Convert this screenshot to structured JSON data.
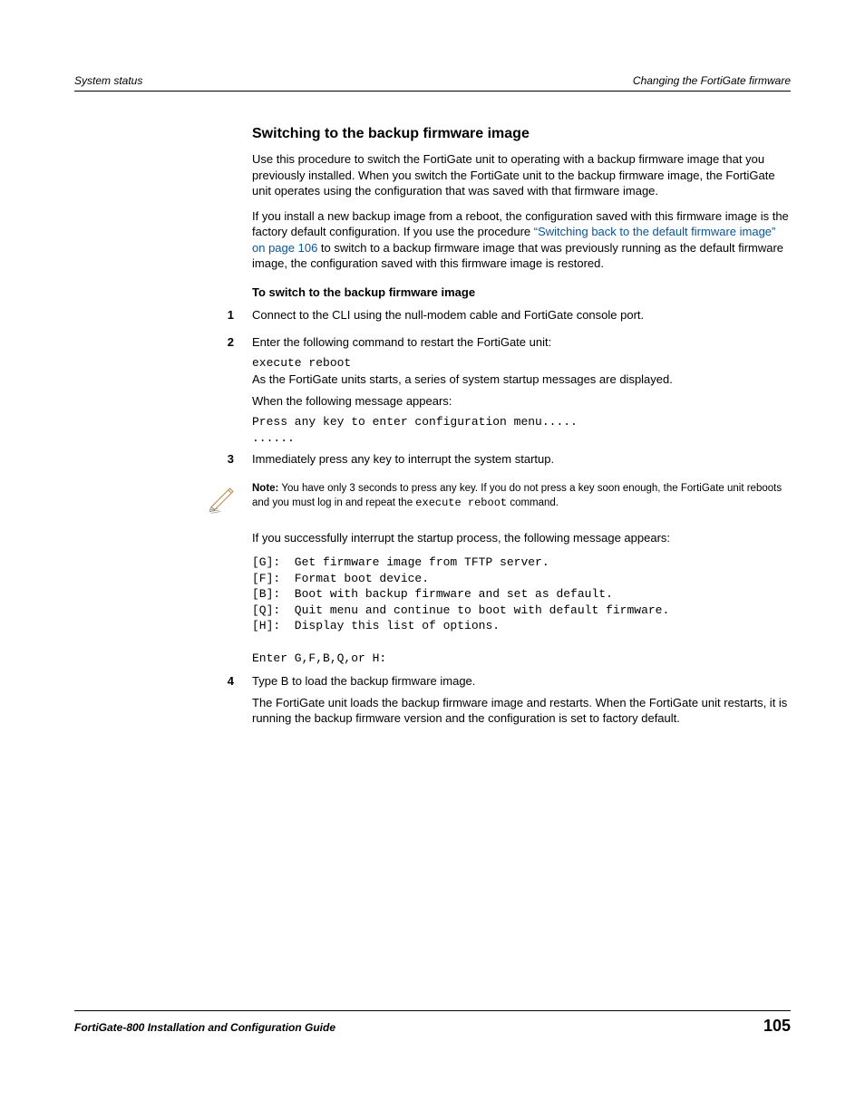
{
  "header": {
    "left": "System status",
    "right": "Changing the FortiGate firmware"
  },
  "title": "Switching to the backup firmware image",
  "intro1": "Use this procedure to switch the FortiGate unit to operating with a backup firmware image that you previously installed. When you switch the FortiGate unit to the backup firmware image, the FortiGate unit operates using the configuration that was saved with that firmware image.",
  "intro2_a": "If you install a new backup image from a reboot, the configuration saved with this firmware image is the factory default configuration. If you use the procedure ",
  "intro2_link": "“Switching back to the default firmware image” on page 106",
  "intro2_b": " to switch to a backup firmware image that was previously running as the default firmware image, the configuration saved with this firmware image is restored.",
  "subhead": "To switch to the backup firmware image",
  "steps": {
    "s1": {
      "num": "1",
      "text": "Connect to the CLI using the null-modem cable and FortiGate console port."
    },
    "s2": {
      "num": "2",
      "text": "Enter the following command to restart the FortiGate unit:",
      "cmd": "execute reboot",
      "after1": "As the FortiGate units starts, a series of system startup messages are displayed.",
      "after2": "When the following message appears:",
      "msg": "Press any key to enter configuration menu.....\n......"
    },
    "s3": {
      "num": "3",
      "text": "Immediately press any key to interrupt the system startup."
    },
    "s4": {
      "num": "4",
      "text": "Type B to load the backup firmware image.",
      "after": "The FortiGate unit loads the backup firmware image and restarts. When the FortiGate unit restarts, it is running the backup firmware version and the configuration is set to factory default."
    }
  },
  "note": {
    "label": "Note:",
    "text_a": " You have only 3 seconds to press any key. If you do not press a key soon enough, the FortiGate unit reboots and you must log in and repeat the ",
    "cmd": "execute reboot",
    "text_b": " command."
  },
  "after_note_text": "If you successfully interrupt the startup process, the following message appears:",
  "menu_block": "[G]:  Get firmware image from TFTP server.\n[F]:  Format boot device.\n[B]:  Boot with backup firmware and set as default.\n[Q]:  Quit menu and continue to boot with default firmware.\n[H]:  Display this list of options.\n\nEnter G,F,B,Q,or H:",
  "footer": {
    "left": "FortiGate-800 Installation and Configuration Guide",
    "right": "105"
  }
}
